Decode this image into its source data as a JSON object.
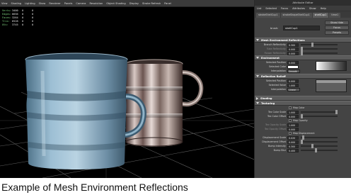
{
  "viewport": {
    "menu": [
      "View",
      "Shading",
      "Lighting",
      "Show",
      "Renderer",
      "Panels",
      "Camera",
      "Resolution",
      "Object Shading",
      "Display",
      "Stroke Refresh",
      "Panel"
    ],
    "hud": [
      {
        "label": "Verts:",
        "a": "3400",
        "b": "0",
        "c": "0"
      },
      {
        "label": "Edges:",
        "a": "6656",
        "b": "0",
        "c": "0"
      },
      {
        "label": "Faces:",
        "a": "3264",
        "b": "0",
        "c": "0"
      },
      {
        "label": "Tris:",
        "a": "6528",
        "b": "0",
        "c": "0"
      },
      {
        "label": "UVs:",
        "a": "3745",
        "b": "0",
        "c": "0"
      }
    ],
    "objects": [
      "blue-cup",
      "chrome-cup",
      "ground-grid"
    ]
  },
  "attr": {
    "title": "Attribute Editor",
    "menu": [
      "List",
      "Selected",
      "Focus",
      "Attributes",
      "Show",
      "Help"
    ],
    "tabs": [
      "strokeShellCup1",
      "strokeShapeShellCup1",
      "shellCup1",
      "time1"
    ],
    "node_label": "brush:",
    "node_value": "shellCup1",
    "focus_btn": "Focus",
    "presets_btn": "Presets",
    "showhide_btn": "Show  Hide",
    "mesh_env": {
      "title": "Mesh Environment Reflections",
      "rows": [
        {
          "label": "Branch Reflectivity",
          "value": "0.300"
        },
        {
          "label": "Tube Reflectivity",
          "value": "0.000"
        },
        {
          "label": "Flower Reflectivity",
          "value": "0.000"
        }
      ]
    },
    "environment": {
      "title": "Environment",
      "rows": [
        {
          "label": "Selected Position",
          "value": "0.000"
        },
        {
          "label": "Selected Color",
          "value": ""
        },
        {
          "label": "Interpolation",
          "value": "Smooth"
        }
      ],
      "ramp_colors": [
        "#ffffff",
        "#b0b0b0",
        "#606060",
        "#2a2a2a"
      ]
    },
    "reflection_rolloff": {
      "title": "Reflection Rolloff",
      "rows": [
        {
          "label": "Selected Position",
          "value": "0.000"
        },
        {
          "label": "Selected Value",
          "value": "1.000"
        },
        {
          "label": "Interpolation",
          "value": "Linear"
        }
      ]
    },
    "shading": {
      "title": "Shading"
    },
    "texturing": {
      "title": "Texturing",
      "checks": [
        "Map Color",
        "Map Opacity",
        "Map Displacement"
      ],
      "rows_color": [
        {
          "label": "Tex Color Scale",
          "value": "1.000"
        },
        {
          "label": "Tex Color Offset",
          "value": "0.000"
        }
      ],
      "rows_opacity": [
        {
          "label": "Tex Opacity Scale",
          "value": "1.000"
        },
        {
          "label": "Tex Opacity Offset",
          "value": "0.000"
        }
      ],
      "rows_disp": [
        {
          "label": "Displacement Scale",
          "value": "0.020"
        },
        {
          "label": "Displacement Offset",
          "value": "0.000"
        },
        {
          "label": "Bump Intensity",
          "value": "0.300"
        },
        {
          "label": "Bump Blur",
          "value": "0.400"
        }
      ]
    }
  },
  "caption": "Example of Mesh Environment Reflections",
  "colors": {
    "accent": "#7fd27f",
    "panel": "#444444",
    "header": "#5b5b5b"
  }
}
